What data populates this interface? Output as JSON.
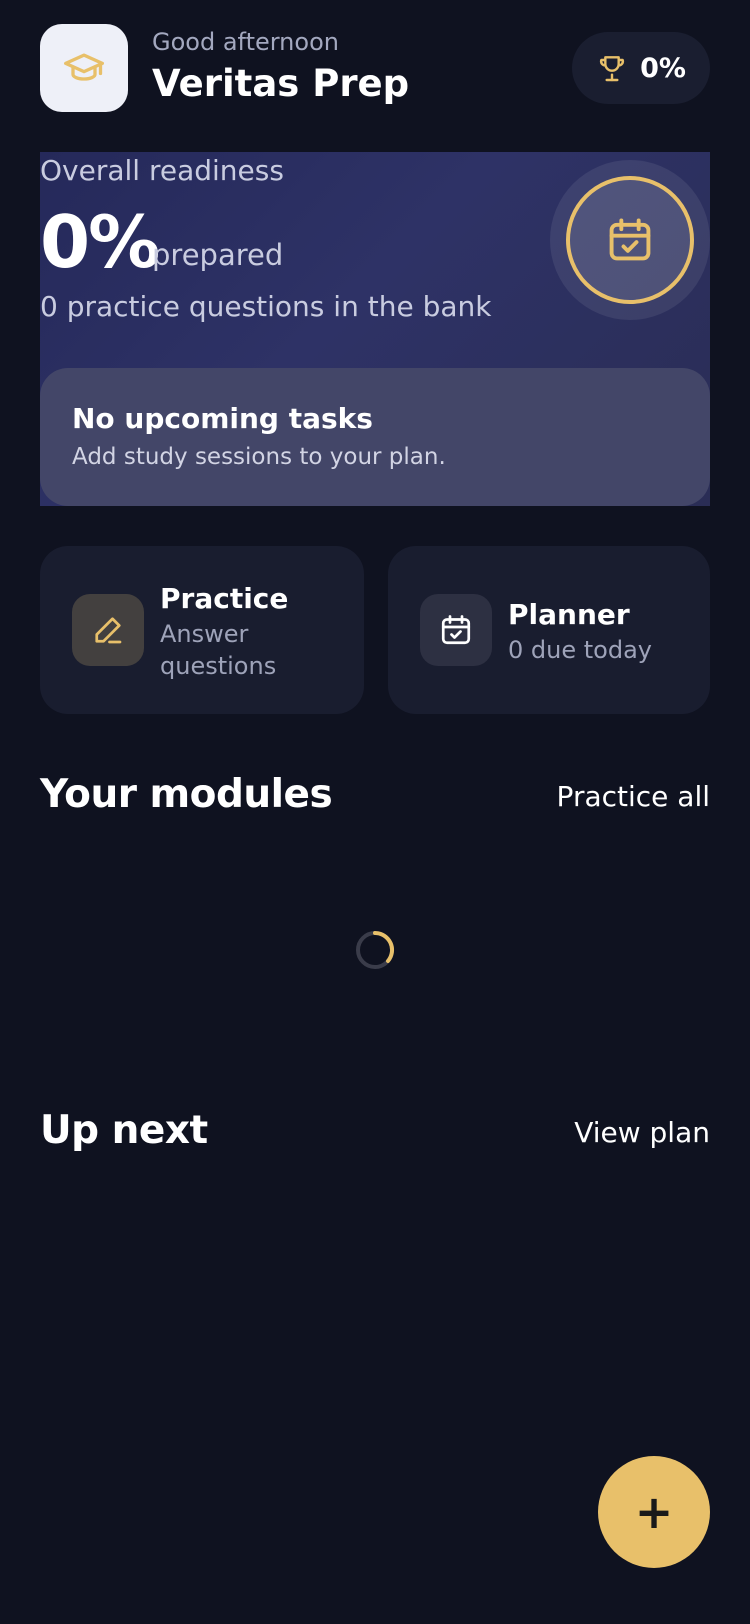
{
  "header": {
    "greeting": "Good afternoon",
    "app_name": "Veritas Prep",
    "score": "0%",
    "logo_icon": "graduation-cap-icon",
    "score_icon": "trophy-icon"
  },
  "hero": {
    "label": "Overall readiness",
    "percent": "0%",
    "suffix": "prepared",
    "subtitle": "0 practice questions in the bank",
    "ring_icon": "calendar-check-icon",
    "tasks": {
      "title": "No upcoming tasks",
      "subtitle": "Add study sessions to your plan."
    }
  },
  "actions": [
    {
      "title": "Practice",
      "subtitle": "Answer questions",
      "icon": "pencil-icon"
    },
    {
      "title": "Planner",
      "subtitle": "0 due today",
      "icon": "calendar-check-icon"
    }
  ],
  "modules": {
    "title": "Your modules",
    "link": "Practice all"
  },
  "up_next": {
    "title": "Up next",
    "link": "View plan"
  },
  "fab": {
    "label": "+"
  },
  "colors": {
    "background": "#0f1220",
    "accent": "#e8c06a",
    "card": "#191d2f"
  }
}
